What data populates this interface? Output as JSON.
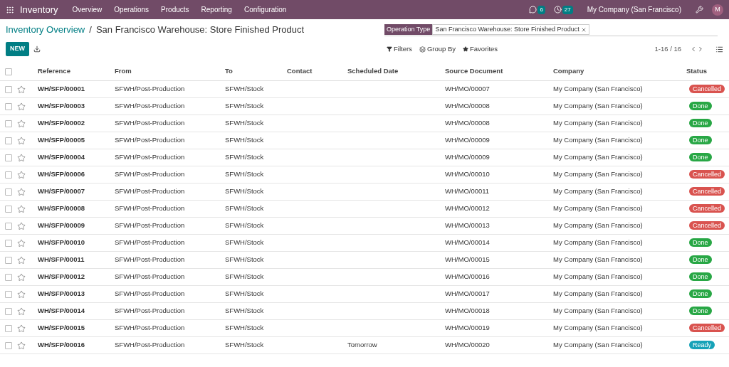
{
  "navbar": {
    "app": "Inventory",
    "menu": [
      "Overview",
      "Operations",
      "Products",
      "Reporting",
      "Configuration"
    ],
    "messages_count": "6",
    "activities_count": "27",
    "company": "My Company (San Francisco)",
    "user_initial": "M"
  },
  "breadcrumb": {
    "parent": "Inventory Overview",
    "separator": "/",
    "current": "San Francisco Warehouse: Store Finished Product"
  },
  "search": {
    "facet_label": "Operation Type",
    "facet_value": "San Francisco Warehouse: Store Finished Product"
  },
  "toolbar": {
    "new_button": "NEW",
    "filters": "Filters",
    "group_by": "Group By",
    "favorites": "Favorites",
    "pager": "1-16 / 16"
  },
  "table": {
    "select_all_checked": false,
    "columns": [
      "Reference",
      "From",
      "To",
      "Contact",
      "Scheduled Date",
      "Source Document",
      "Company",
      "Status"
    ],
    "rows": [
      {
        "checked": false,
        "reference": "WH/SFP/00001",
        "from": "SFWH/Post-Production",
        "to": "SFWH/Stock",
        "source": "WH/MO/00007",
        "company": "My Company (San Francisco)",
        "status": "Cancelled",
        "color": "#d9534f"
      },
      {
        "checked": false,
        "reference": "WH/SFP/00003",
        "from": "SFWH/Post-Production",
        "to": "SFWH/Stock",
        "source": "WH/MO/00008",
        "company": "My Company (San Francisco)",
        "status": "Done",
        "color": "#28a745"
      },
      {
        "checked": false,
        "reference": "WH/SFP/00002",
        "from": "SFWH/Post-Production",
        "to": "SFWH/Stock",
        "source": "WH/MO/00008",
        "company": "My Company (San Francisco)",
        "status": "Done",
        "color": "#28a745"
      },
      {
        "checked": false,
        "reference": "WH/SFP/00005",
        "from": "SFWH/Post-Production",
        "to": "SFWH/Stock",
        "source": "WH/MO/00009",
        "company": "My Company (San Francisco)",
        "status": "Done",
        "color": "#28a745"
      },
      {
        "checked": false,
        "reference": "WH/SFP/00004",
        "from": "SFWH/Post-Production",
        "to": "SFWH/Stock",
        "source": "WH/MO/00009",
        "company": "My Company (San Francisco)",
        "status": "Done",
        "color": "#28a745"
      },
      {
        "checked": false,
        "reference": "WH/SFP/00006",
        "from": "SFWH/Post-Production",
        "to": "SFWH/Stock",
        "source": "WH/MO/00010",
        "company": "My Company (San Francisco)",
        "status": "Cancelled",
        "color": "#d9534f"
      },
      {
        "checked": false,
        "reference": "WH/SFP/00007",
        "from": "SFWH/Post-Production",
        "to": "SFWH/Stock",
        "source": "WH/MO/00011",
        "company": "My Company (San Francisco)",
        "status": "Cancelled",
        "color": "#d9534f"
      },
      {
        "checked": false,
        "reference": "WH/SFP/00008",
        "from": "SFWH/Post-Production",
        "to": "SFWH/Stock",
        "source": "WH/MO/00012",
        "company": "My Company (San Francisco)",
        "status": "Cancelled",
        "color": "#d9534f"
      },
      {
        "checked": false,
        "reference": "WH/SFP/00009",
        "from": "SFWH/Post-Production",
        "to": "SFWH/Stock",
        "source": "WH/MO/00013",
        "company": "My Company (San Francisco)",
        "status": "Cancelled",
        "color": "#d9534f"
      },
      {
        "checked": false,
        "reference": "WH/SFP/00010",
        "from": "SFWH/Post-Production",
        "to": "SFWH/Stock",
        "source": "WH/MO/00014",
        "company": "My Company (San Francisco)",
        "status": "Done",
        "color": "#28a745"
      },
      {
        "checked": false,
        "reference": "WH/SFP/00011",
        "from": "SFWH/Post-Production",
        "to": "SFWH/Stock",
        "source": "WH/MO/00015",
        "company": "My Company (San Francisco)",
        "status": "Done",
        "color": "#28a745"
      },
      {
        "checked": false,
        "reference": "WH/SFP/00012",
        "from": "SFWH/Post-Production",
        "to": "SFWH/Stock",
        "source": "WH/MO/00016",
        "company": "My Company (San Francisco)",
        "status": "Done",
        "color": "#28a745"
      },
      {
        "checked": false,
        "reference": "WH/SFP/00013",
        "from": "SFWH/Post-Production",
        "to": "SFWH/Stock",
        "source": "WH/MO/00017",
        "company": "My Company (San Francisco)",
        "status": "Done",
        "color": "#28a745"
      },
      {
        "checked": false,
        "reference": "WH/SFP/00014",
        "from": "SFWH/Post-Production",
        "to": "SFWH/Stock",
        "source": "WH/MO/00018",
        "company": "My Company (San Francisco)",
        "status": "Done",
        "color": "#28a745"
      },
      {
        "checked": false,
        "reference": "WH/SFP/00015",
        "from": "SFWH/Post-Production",
        "to": "SFWH/Stock",
        "source": "WH/MO/00019",
        "company": "My Company (San Francisco)",
        "status": "Cancelled",
        "color": "#d9534f"
      },
      {
        "checked": false,
        "reference": "WH/SFP/00016",
        "from": "SFWH/Post-Production",
        "to": "SFWH/Stock",
        "scheduled_date": "Tomorrow",
        "source": "WH/MO/00020",
        "company": "My Company (San Francisco)",
        "status": "Ready",
        "color": "#17a2b8"
      }
    ]
  }
}
